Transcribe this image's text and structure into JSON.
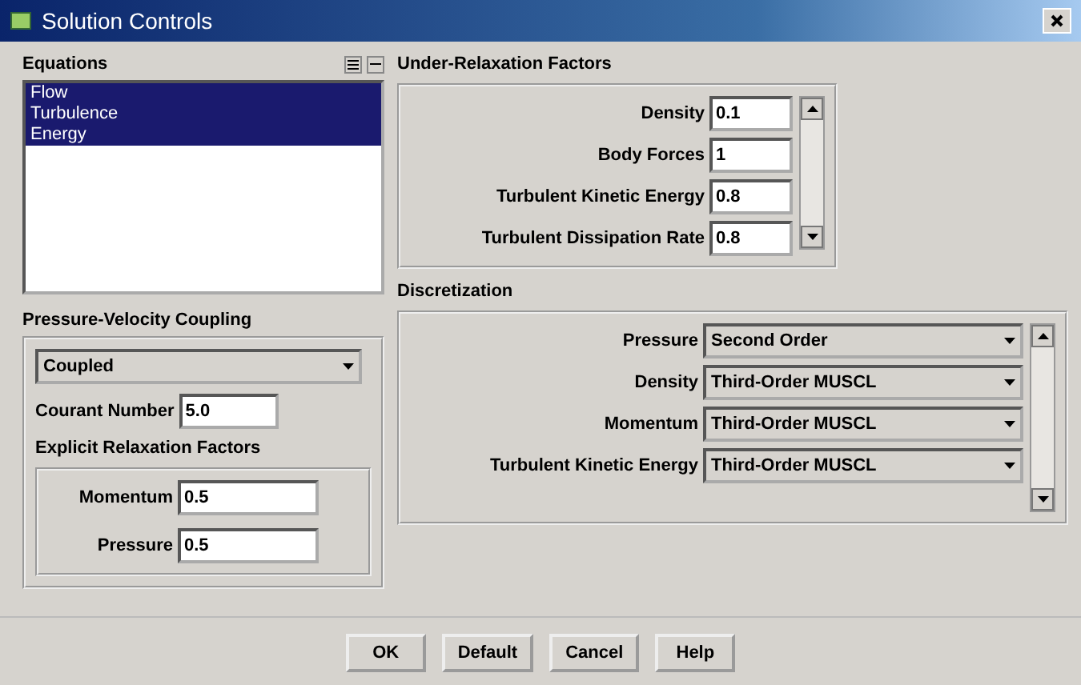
{
  "window": {
    "title": "Solution Controls"
  },
  "equations": {
    "label": "Equations",
    "items": [
      {
        "label": "Flow",
        "selected": true
      },
      {
        "label": "Turbulence",
        "selected": true
      },
      {
        "label": "Energy",
        "selected": true
      }
    ]
  },
  "under_relaxation": {
    "label": "Under-Relaxation Factors",
    "fields": [
      {
        "label": "Density",
        "value": "0.1"
      },
      {
        "label": "Body Forces",
        "value": "1"
      },
      {
        "label": "Turbulent Kinetic Energy",
        "value": "0.8"
      },
      {
        "label": "Turbulent Dissipation Rate",
        "value": "0.8"
      }
    ]
  },
  "pressure_velocity_coupling": {
    "label": "Pressure-Velocity Coupling",
    "scheme": "Coupled",
    "courant": {
      "label": "Courant Number",
      "value": "5.0"
    },
    "explicit": {
      "label": "Explicit Relaxation Factors",
      "fields": [
        {
          "label": "Momentum",
          "value": "0.5"
        },
        {
          "label": "Pressure",
          "value": "0.5"
        }
      ]
    }
  },
  "discretization": {
    "label": "Discretization",
    "fields": [
      {
        "label": "Pressure",
        "value": "Second Order"
      },
      {
        "label": "Density",
        "value": "Third-Order MUSCL"
      },
      {
        "label": "Momentum",
        "value": "Third-Order MUSCL"
      },
      {
        "label": "Turbulent Kinetic Energy",
        "value": "Third-Order MUSCL"
      }
    ]
  },
  "buttons": [
    "OK",
    "Default",
    "Cancel",
    "Help"
  ]
}
